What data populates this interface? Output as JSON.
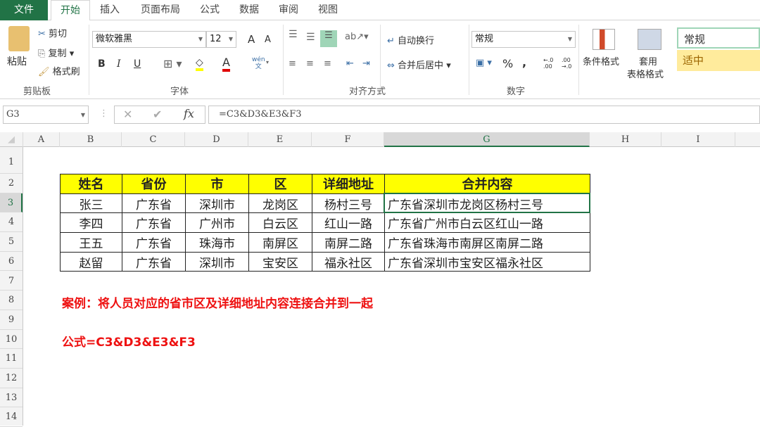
{
  "tabs": [
    "文件",
    "开始",
    "插入",
    "页面布局",
    "公式",
    "数据",
    "审阅",
    "视图"
  ],
  "clipboard": {
    "paste": "粘贴",
    "cut": "剪切",
    "copy": "复制",
    "format_painter": "格式刷",
    "label": "剪贴板"
  },
  "font": {
    "name": "微软雅黑",
    "size": "12",
    "bold": "B",
    "italic": "I",
    "underline": "U",
    "label": "字体",
    "grow": "A",
    "shrink": "A",
    "phonetic": "wén\n文"
  },
  "alignment": {
    "wrap": "自动换行",
    "merge": "合并后居中",
    "label": "对齐方式"
  },
  "number": {
    "format": "常规",
    "percent": "%",
    "comma": ",",
    "label": "数字",
    "inc": "←.0 .00",
    "dec": ".00 →.0"
  },
  "styles": {
    "conditional": "条件格式",
    "table_format_1": "套用",
    "table_format_2": "表格格式",
    "normal": "常规",
    "neutral": "适中"
  },
  "formula_bar": {
    "name_box": "G3",
    "fx": "fx",
    "formula": "=C3&D3&E3&F3"
  },
  "columns": [
    "A",
    "B",
    "C",
    "D",
    "E",
    "F",
    "G",
    "H",
    "I"
  ],
  "rows": [
    "1",
    "2",
    "3",
    "4",
    "5",
    "6",
    "7",
    "8",
    "9",
    "10",
    "11",
    "12",
    "13",
    "14"
  ],
  "table": {
    "headers": [
      "姓名",
      "省份",
      "市",
      "区",
      "详细地址",
      "合并内容"
    ],
    "rows": [
      [
        "张三",
        "广东省",
        "深圳市",
        "龙岗区",
        "杨村三号",
        "广东省深圳市龙岗区杨村三号"
      ],
      [
        "李四",
        "广东省",
        "广州市",
        "白云区",
        "红山一路",
        "广东省广州市白云区红山一路"
      ],
      [
        "王五",
        "广东省",
        "珠海市",
        "南屏区",
        "南屏二路",
        "广东省珠海市南屏区南屏二路"
      ],
      [
        "赵留",
        "广东省",
        "深圳市",
        "宝安区",
        "福永社区",
        "广东省深圳市宝安区福永社区"
      ]
    ]
  },
  "notes": {
    "example": "案例：将人员对应的省市区及详细地址内容连接合并到一起",
    "formula": "公式=C3&D3&E3&F3"
  }
}
